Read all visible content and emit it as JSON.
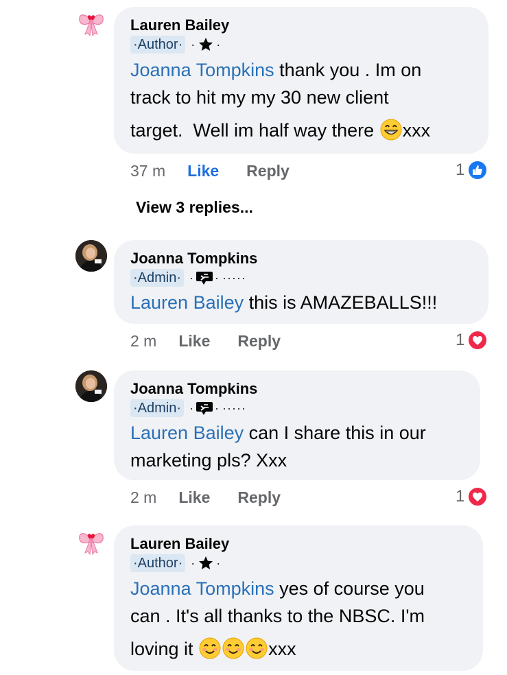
{
  "comments": [
    {
      "author": "Lauren Bailey",
      "badge": "·Author·",
      "badge_sep": "·",
      "mention": "Joanna Tompkins",
      "body_lines": [
        " thank you . Im on",
        "track to hit my my 30 new client",
        "target.  Well im half way there "
      ],
      "suffix": "xxx",
      "time": "37 m",
      "like": "Like",
      "reply": "Reply",
      "reaction_count": "1",
      "reaction": "like"
    },
    {
      "author": "Joanna Tompkins",
      "badge": "·Admin·",
      "badge_sep": "·",
      "dots": "·····",
      "mention": "Lauren Bailey",
      "body": " this is AMAZEBALLS!!!",
      "time": "2 m",
      "like": "Like",
      "reply": "Reply",
      "reaction_count": "1",
      "reaction": "love"
    },
    {
      "author": "Joanna Tompkins",
      "badge": "·Admin·",
      "badge_sep": "·",
      "dots": "·····",
      "mention": "Lauren Bailey",
      "body_lines": [
        " can I share this in our",
        "marketing pls? Xxx"
      ],
      "time": "2 m",
      "like": "Like",
      "reply": "Reply",
      "reaction_count": "1",
      "reaction": "love"
    },
    {
      "author": "Lauren Bailey",
      "badge": "·Author·",
      "badge_sep": "·",
      "mention": "Joanna Tompkins",
      "body_lines": [
        " yes of course you",
        "can . It's all thanks to the NBSC. I'm",
        "loving it "
      ],
      "suffix": "xxx"
    }
  ],
  "view_replies": "View 3 replies...",
  "colors": {
    "mention": "#2a70b8",
    "like_active": "#216fdb",
    "love": "#f02849",
    "bubble": "#f0f2f5"
  }
}
